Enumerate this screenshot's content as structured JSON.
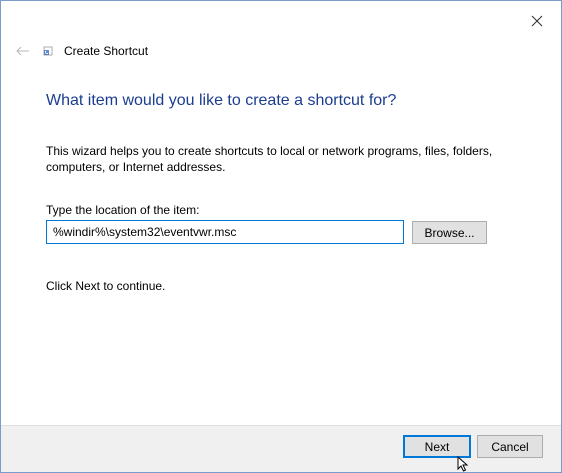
{
  "window": {
    "title": "Create Shortcut",
    "close_icon": "close-icon",
    "back_icon": "back-arrow-icon",
    "app_icon": "shortcut-icon"
  },
  "main": {
    "heading": "What item would you like to create a shortcut for?",
    "description": "This wizard helps you to create shortcuts to local or network programs, files, folders, computers, or Internet addresses.",
    "location_label": "Type the location of the item:",
    "location_value": "%windir%\\system32\\eventvwr.msc",
    "browse_label": "Browse...",
    "hint": "Click Next to continue."
  },
  "footer": {
    "next_label": "Next",
    "cancel_label": "Cancel"
  },
  "colors": {
    "heading": "#1b3d8f",
    "accent": "#0078d7",
    "footer_bg": "#f0f0f0",
    "button_bg": "#e1e1e1"
  }
}
